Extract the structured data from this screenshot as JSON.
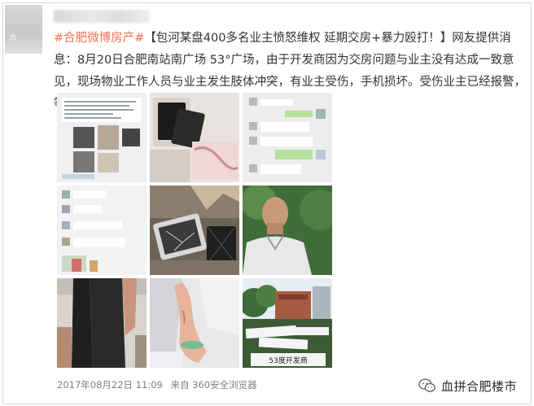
{
  "post": {
    "hashtag": "#合肥微博房产#",
    "body": "【包河某盘400多名业主愤怒维权 延期交房+暴力殴打！】网友提供消息：8月20日合肥南站南广场 53°广场，由于开发商因为交房问题与业主没有达成一致意见，现场物业工作人员与业主发生肢体冲突，有业主受伤，手机损坏。受伤业主已经报警，等待警方处理。"
  },
  "photos": [
    {
      "name": "chat-screenshot",
      "caption": ""
    },
    {
      "name": "phone-photo",
      "caption": ""
    },
    {
      "name": "chat-screenshot",
      "caption": ""
    },
    {
      "name": "chat-screenshot",
      "caption": ""
    },
    {
      "name": "broken-tablet-photo",
      "caption": ""
    },
    {
      "name": "man-photo",
      "caption": ""
    },
    {
      "name": "woman-photo",
      "caption": ""
    },
    {
      "name": "injured-arm-photo",
      "caption": ""
    },
    {
      "name": "protest-banner-photo",
      "caption": "53度开发商"
    }
  ],
  "footer": {
    "timestamp": "2017年08月22日 11:09",
    "source": "来自 360安全浏览器"
  },
  "watermark": {
    "icon": "wechat-icon",
    "text": "血拼合肥楼市"
  },
  "avatar": {
    "caption": "合"
  }
}
